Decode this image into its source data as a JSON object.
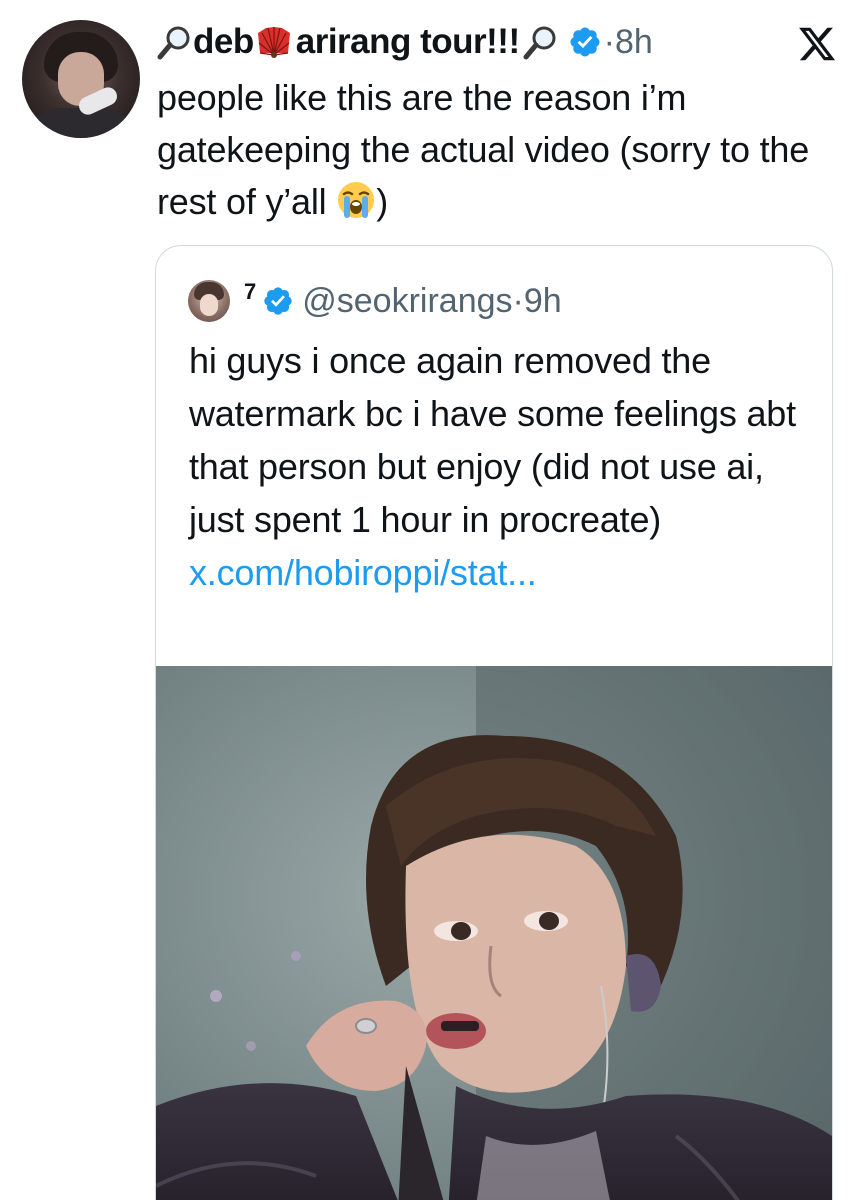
{
  "tweet": {
    "display_name_prefix": "deb",
    "display_name_suffix": "arirang tour!!!",
    "time": "8h",
    "separator": "·",
    "text": "people like this are the reason i’m gatekeeping the actual video (sorry to the rest of y’all ",
    "text_end": ")",
    "icons": [
      "magnifying-glass-left-icon",
      "folding-fan-icon",
      "magnifying-glass-right-icon",
      "verified-badge-icon",
      "x-logo-icon",
      "loudly-crying-face-icon"
    ]
  },
  "quote": {
    "display_name": "7",
    "handle": "@seokrirangs",
    "separator": "·",
    "time": "9h",
    "text": "hi guys i once again removed the watermark bc i have some feelings abt that person but enjoy (did not use ai, just spent 1 hour in procreate) ",
    "link_text": "x.com/hobiroppi/stat..."
  },
  "colors": {
    "verified_blue": "#1d9bf0",
    "secondary_text": "#536471",
    "border": "#cfd9de",
    "link": "#1d9bf0"
  }
}
